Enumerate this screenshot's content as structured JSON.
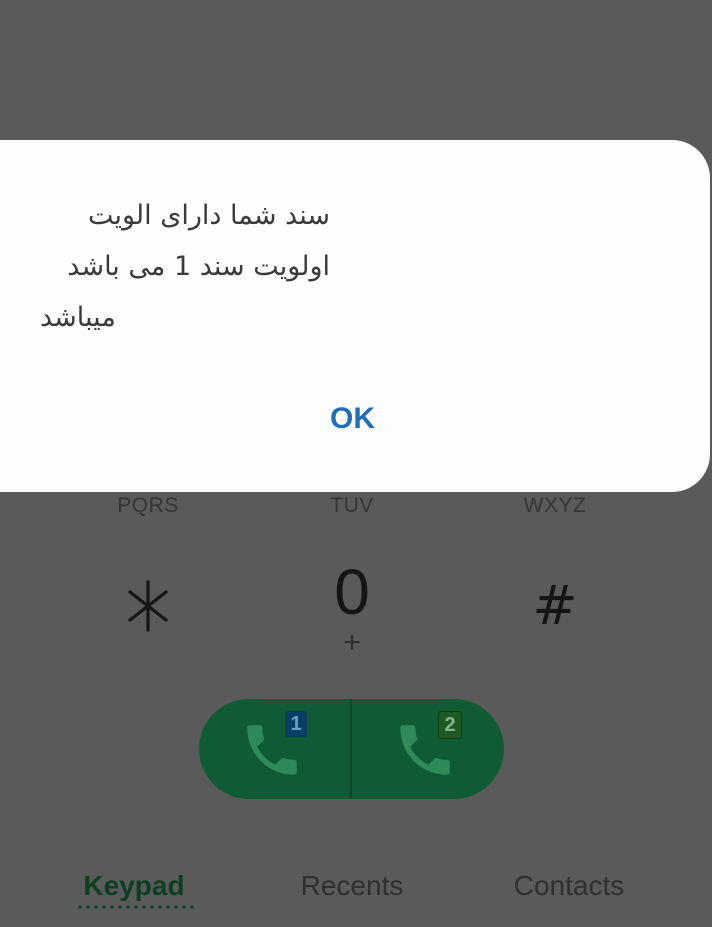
{
  "dialog": {
    "message_lines": [
      "سند شما دارای الویت",
      "اولویت سند 1 می باشد",
      "میباشد"
    ],
    "ok_label": "OK"
  },
  "keypad": {
    "sub_labels": [
      "PQRS",
      "TUV",
      "WXYZ"
    ],
    "zero_digit": "0",
    "zero_sub": "+",
    "hash": "#"
  },
  "call_buttons": {
    "sim1_badge": "1",
    "sim2_badge": "2",
    "color": "#0f5c34"
  },
  "tabs": {
    "keypad": "Keypad",
    "recents": "Recents",
    "contacts": "Contacts",
    "active": "keypad"
  },
  "colors": {
    "accent_link": "#1f6fb8",
    "call_green": "#0f5c34",
    "overlay": "#5a5a5a"
  },
  "icons": {
    "star": "asterisk-icon",
    "call": "phone-icon"
  }
}
